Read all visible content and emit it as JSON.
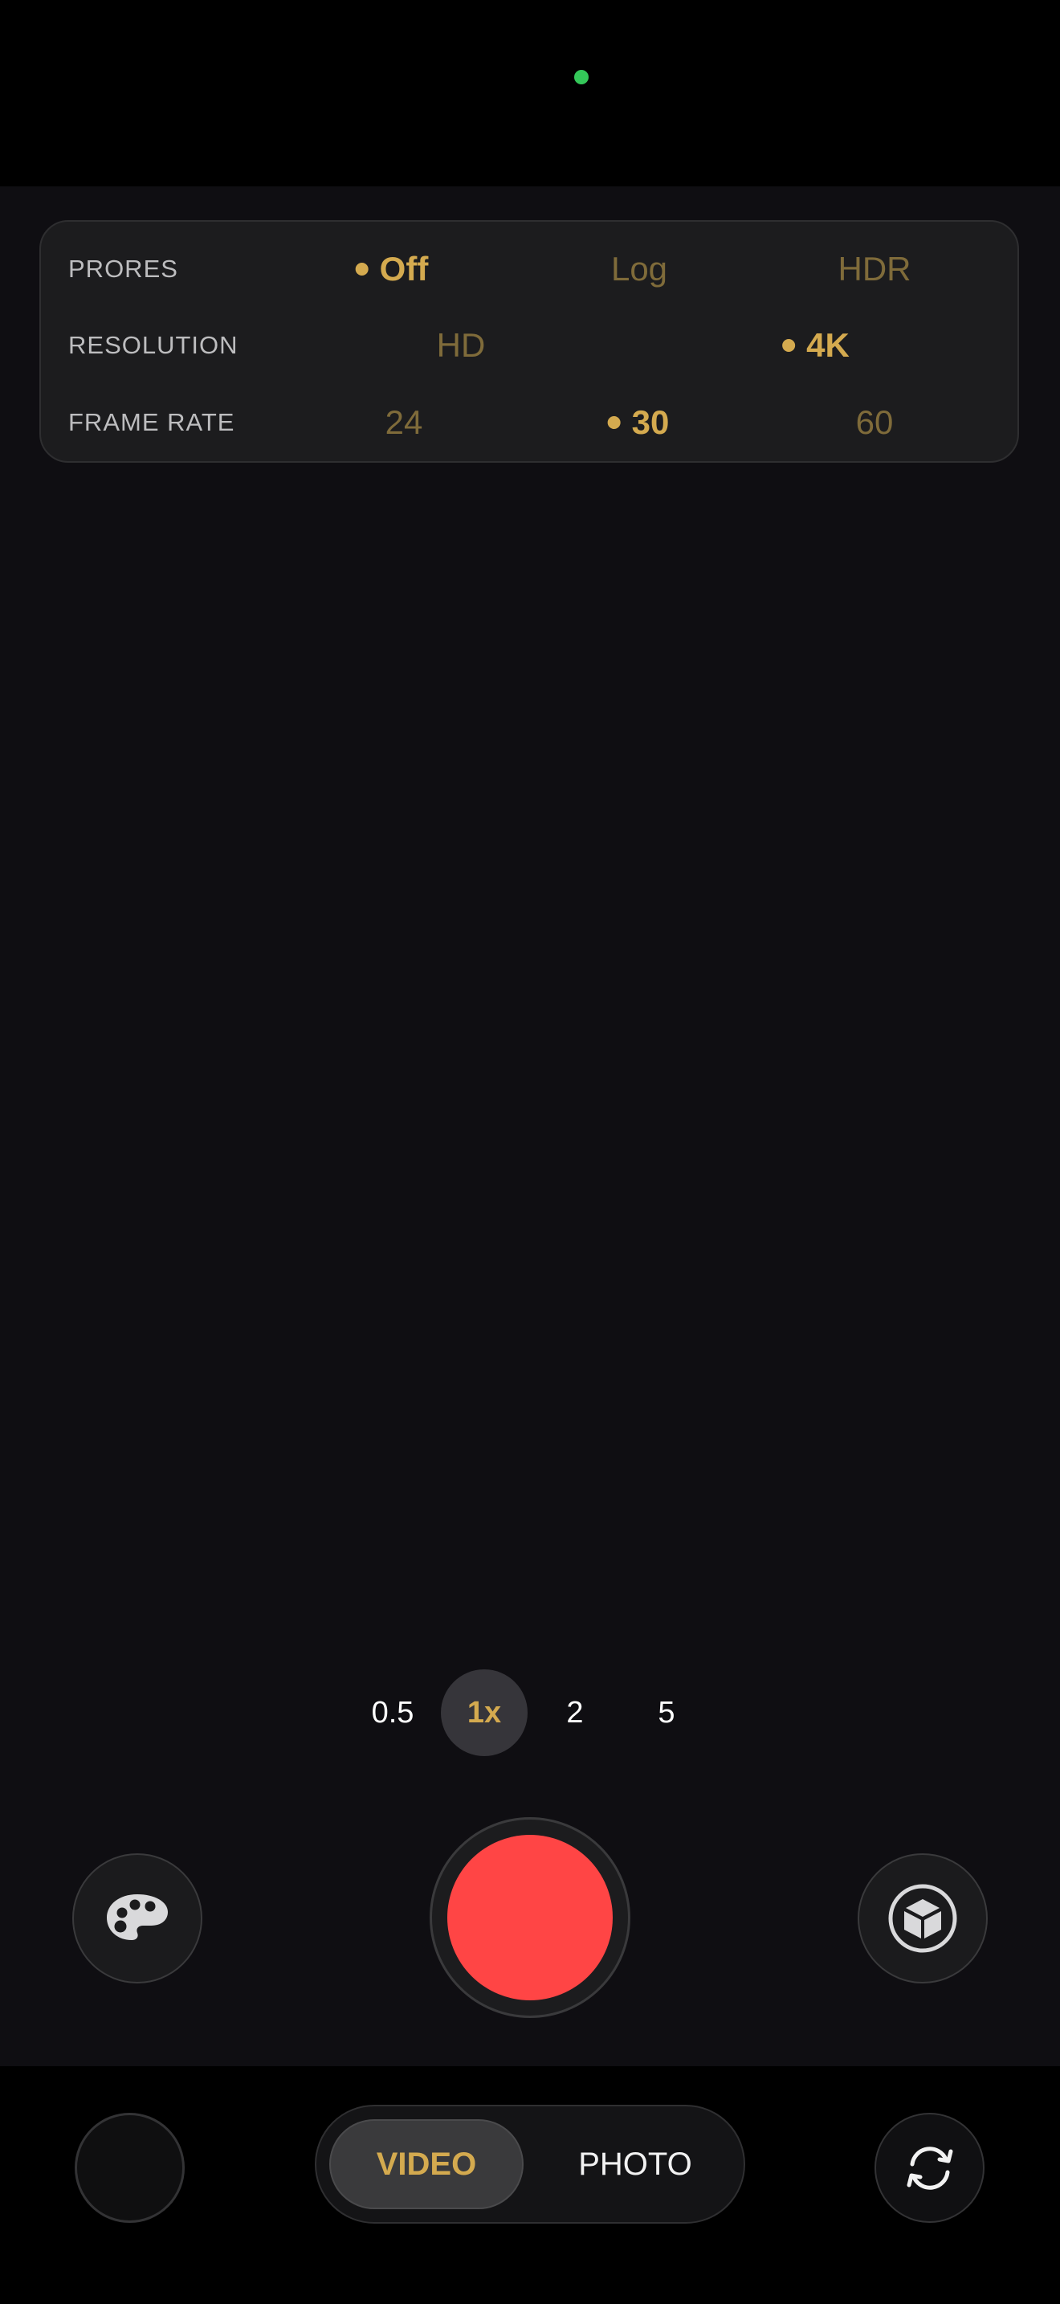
{
  "colors": {
    "accent_selected": "#d4aa4f",
    "accent_unselected": "#7f6b3a",
    "record": "#ff4545",
    "indicator": "#34c759"
  },
  "status": {
    "indicator_icon": "camera-in-use-dot"
  },
  "settings": {
    "prores": {
      "label": "PRORES",
      "options": [
        "Off",
        "Log",
        "HDR"
      ],
      "selected": "Off"
    },
    "resolution": {
      "label": "RESOLUTION",
      "options": [
        "HD",
        "4K"
      ],
      "selected": "4K"
    },
    "frame_rate": {
      "label": "FRAME RATE",
      "options": [
        "24",
        "30",
        "60"
      ],
      "selected": "30"
    }
  },
  "zoom": {
    "options": [
      "0.5",
      "1x",
      "2",
      "5"
    ],
    "selected": "1x"
  },
  "controls": {
    "left_icon": "palette-icon",
    "right_icon": "cube-icon",
    "record_icon": "record-button",
    "switch_camera_icon": "camera-switch-icon",
    "thumbnail_icon": "gallery-thumbnail"
  },
  "modes": {
    "options": [
      "VIDEO",
      "PHOTO"
    ],
    "selected": "VIDEO"
  }
}
